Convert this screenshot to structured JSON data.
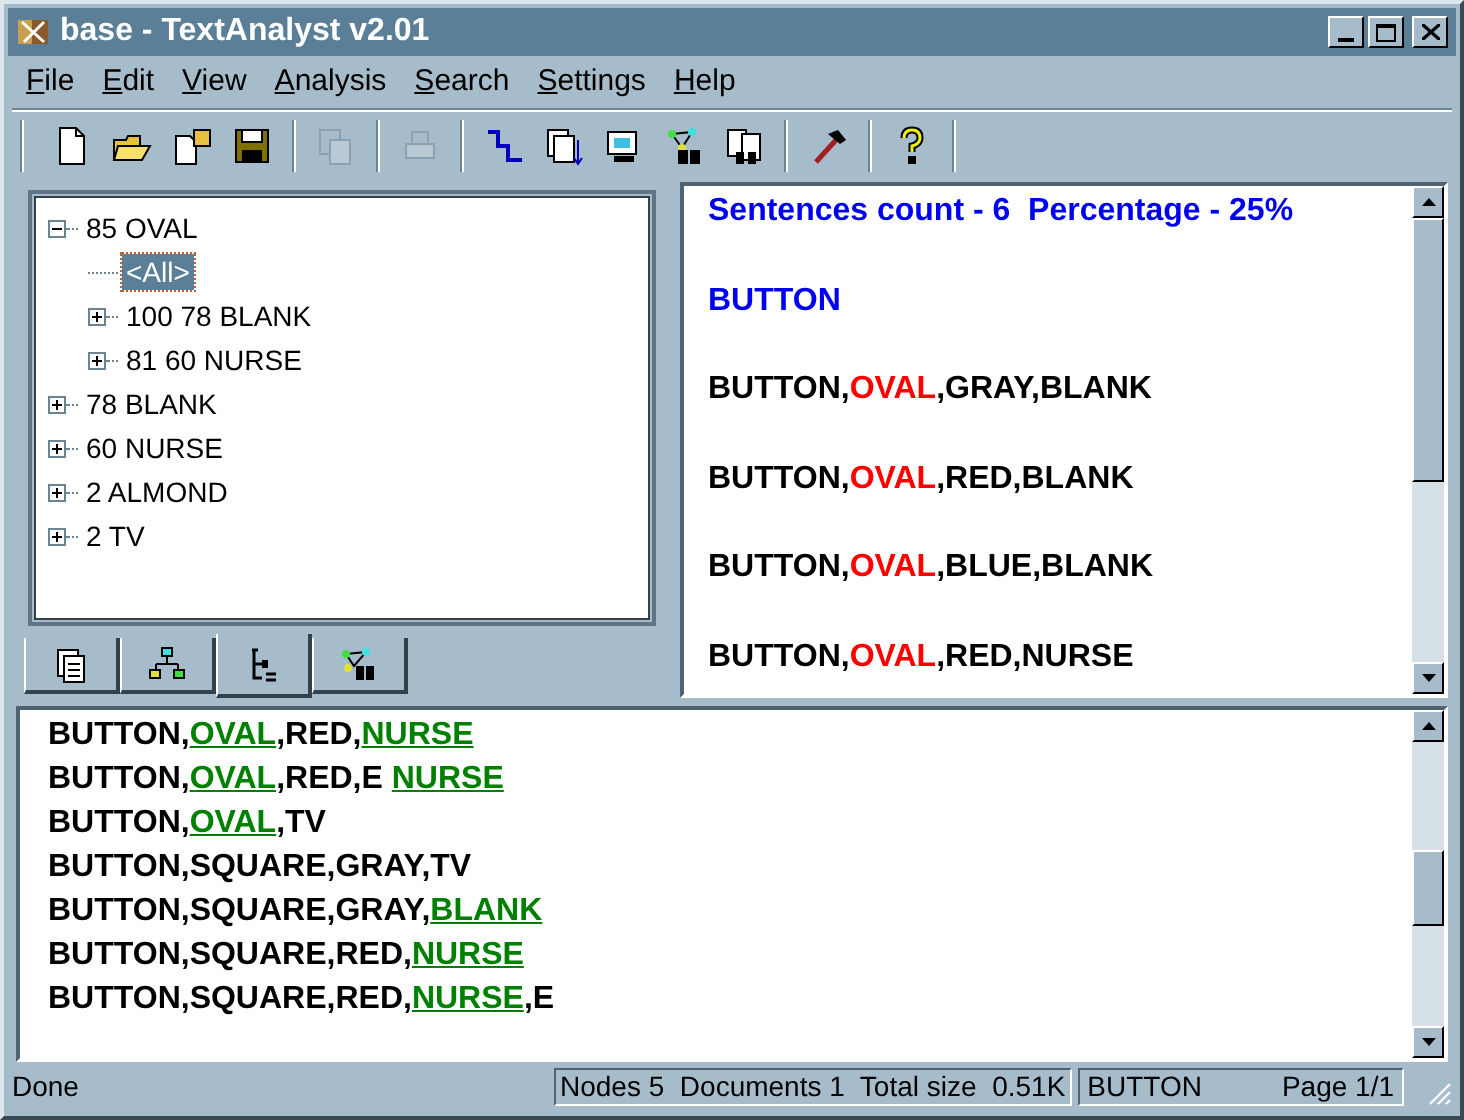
{
  "window": {
    "title": "base - TextAnalyst v2.01"
  },
  "menu": [
    "File",
    "Edit",
    "View",
    "Analysis",
    "Search",
    "Settings",
    "Help"
  ],
  "toolbar": [
    {
      "kind": "new",
      "disabled": false
    },
    {
      "kind": "open",
      "disabled": false
    },
    {
      "kind": "import",
      "disabled": false
    },
    {
      "kind": "save",
      "disabled": false
    },
    {
      "kind": "separator"
    },
    {
      "kind": "copy",
      "disabled": true
    },
    {
      "kind": "separator"
    },
    {
      "kind": "print",
      "disabled": true
    },
    {
      "kind": "separator"
    },
    {
      "kind": "steps",
      "disabled": false
    },
    {
      "kind": "stack",
      "disabled": false
    },
    {
      "kind": "monitor",
      "disabled": false
    },
    {
      "kind": "network",
      "disabled": false
    },
    {
      "kind": "docs",
      "disabled": false
    },
    {
      "kind": "separator"
    },
    {
      "kind": "hammer",
      "disabled": false
    },
    {
      "kind": "separator"
    },
    {
      "kind": "help",
      "disabled": false
    }
  ],
  "tree": [
    {
      "label": "85 OVAL",
      "expanded": true,
      "selected": false,
      "children": [
        {
          "label": "<All>",
          "selected": true
        },
        {
          "label": "100 78 BLANK",
          "expanded": false,
          "selected": false
        },
        {
          "label": "81 60 NURSE",
          "expanded": false,
          "selected": false
        }
      ]
    },
    {
      "label": "78 BLANK",
      "expanded": false,
      "selected": false
    },
    {
      "label": "60 NURSE",
      "expanded": false,
      "selected": false
    },
    {
      "label": "2 ALMOND",
      "expanded": false,
      "selected": false
    },
    {
      "label": "2 TV",
      "expanded": false,
      "selected": false
    }
  ],
  "tabs": [
    {
      "kind": "documents",
      "selected": false
    },
    {
      "kind": "hierarchy",
      "selected": false
    },
    {
      "kind": "tree",
      "selected": true
    },
    {
      "kind": "search",
      "selected": false
    }
  ],
  "summary_pane": {
    "lines": [
      [
        {
          "text": "Sentences count - 6  Percentage - 25%",
          "kind": "heading"
        }
      ],
      [
        {
          "text": "BUTTON",
          "kind": "heading"
        }
      ],
      [
        {
          "text": "BUTTON,",
          "kind": "plain"
        },
        {
          "text": "OVAL",
          "kind": "highlight"
        },
        {
          "text": ",GRAY,BLANK",
          "kind": "plain"
        }
      ],
      [
        {
          "text": "BUTTON,",
          "kind": "plain"
        },
        {
          "text": "OVAL",
          "kind": "highlight"
        },
        {
          "text": ",RED,BLANK",
          "kind": "plain"
        }
      ],
      [
        {
          "text": "BUTTON,",
          "kind": "plain"
        },
        {
          "text": "OVAL",
          "kind": "highlight"
        },
        {
          "text": ",BLUE,BLANK",
          "kind": "plain"
        }
      ],
      [
        {
          "text": "BUTTON,",
          "kind": "plain"
        },
        {
          "text": "OVAL",
          "kind": "highlight"
        },
        {
          "text": ",RED,NURSE",
          "kind": "plain"
        }
      ]
    ]
  },
  "text_pane": {
    "lines": [
      [
        {
          "text": "BUTTON,",
          "kind": "plain"
        },
        {
          "text": "OVAL",
          "kind": "highlight"
        },
        {
          "text": ",RED,",
          "kind": "plain"
        },
        {
          "text": "NURSE",
          "kind": "highlight"
        }
      ],
      [
        {
          "text": "BUTTON,",
          "kind": "plain"
        },
        {
          "text": "OVAL",
          "kind": "highlight"
        },
        {
          "text": ",RED,E ",
          "kind": "plain"
        },
        {
          "text": "NURSE",
          "kind": "highlight"
        }
      ],
      [
        {
          "text": "BUTTON,",
          "kind": "plain"
        },
        {
          "text": "OVAL",
          "kind": "highlight"
        },
        {
          "text": ",TV",
          "kind": "plain"
        }
      ],
      [
        {
          "text": "BUTTON,SQUARE,GRAY,TV",
          "kind": "plain"
        }
      ],
      [
        {
          "text": "BUTTON,SQUARE,GRAY,",
          "kind": "plain"
        },
        {
          "text": "BLANK",
          "kind": "highlight"
        }
      ],
      [
        {
          "text": "BUTTON,SQUARE,RED,",
          "kind": "plain"
        },
        {
          "text": "NURSE",
          "kind": "highlight"
        }
      ],
      [
        {
          "text": "BUTTON,SQUARE,RED,",
          "kind": "plain"
        },
        {
          "text": "NURSE",
          "kind": "highlight"
        },
        {
          "text": ",E",
          "kind": "plain"
        }
      ]
    ]
  },
  "status_bar": {
    "message": "Done",
    "stats": "Nodes 5  Documents 1  Total size  0.51K",
    "word": "BUTTON",
    "page": "Page 1/1"
  }
}
